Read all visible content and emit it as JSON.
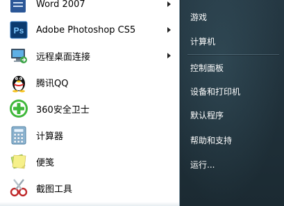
{
  "programs": [
    {
      "label": "Word 2007",
      "icon": "word-icon",
      "submenu": true
    },
    {
      "label": "Adobe Photoshop CS5",
      "icon": "photoshop-icon",
      "submenu": true
    },
    {
      "label": "远程桌面连接",
      "icon": "remote-desktop-icon",
      "submenu": true
    },
    {
      "label": "腾讯QQ",
      "icon": "qq-penguin-icon",
      "submenu": false
    },
    {
      "label": "360安全卫士",
      "icon": "360-safeguard-icon",
      "submenu": false
    },
    {
      "label": "计算器",
      "icon": "calculator-icon",
      "submenu": false
    },
    {
      "label": "便笺",
      "icon": "sticky-notes-icon",
      "submenu": false
    },
    {
      "label": "截图工具",
      "icon": "snipping-tool-icon",
      "submenu": false
    }
  ],
  "ps_icon_text": "Ps",
  "right_items": [
    {
      "label": "游戏"
    },
    {
      "label": "计算机"
    },
    {
      "label": "控制面板"
    },
    {
      "label": "设备和打印机"
    },
    {
      "label": "默认程序"
    },
    {
      "label": "帮助和支持"
    },
    {
      "label": "运行..."
    }
  ],
  "colors": {
    "photoshop_bg": "#0b3a6e",
    "photoshop_text": "#7ec8ff",
    "qq_black": "#111111",
    "qq_yellow": "#f7c21c",
    "safe360_green": "#3fb83a",
    "right_pane": "#223540"
  }
}
